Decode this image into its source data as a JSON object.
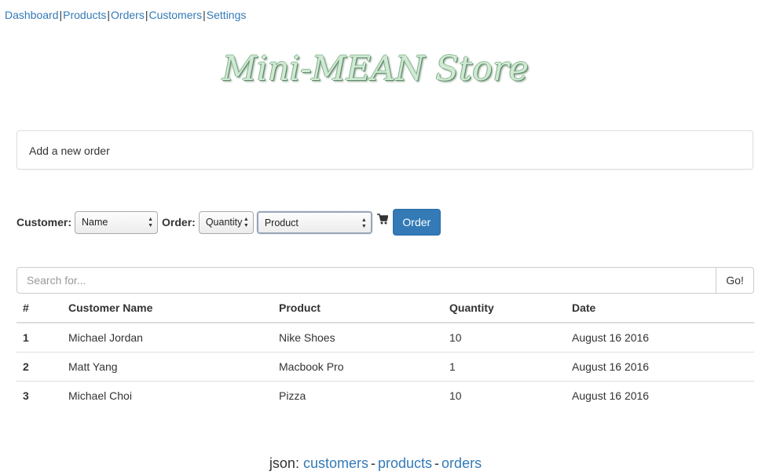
{
  "nav": {
    "items": [
      {
        "label": "Dashboard"
      },
      {
        "label": "Products"
      },
      {
        "label": "Orders"
      },
      {
        "label": "Customers"
      },
      {
        "label": "Settings"
      }
    ],
    "separator": "|"
  },
  "brand": {
    "title": "Mini-MEAN Store"
  },
  "panel": {
    "heading": "Add a new order"
  },
  "order_form": {
    "customer_label": "Customer:",
    "customer_select": "Name",
    "order_label": "Order:",
    "quantity_select": "Quantity",
    "product_select": "Product",
    "cart_icon": "shopping-cart-icon",
    "order_button": "Order"
  },
  "search": {
    "placeholder": "Search for...",
    "value": "",
    "go_button": "Go!"
  },
  "table": {
    "headers": [
      "#",
      "Customer Name",
      "Product",
      "Quantity",
      "Date"
    ],
    "rows": [
      {
        "num": "1",
        "customer": "Michael Jordan",
        "product": "Nike Shoes",
        "quantity": "10",
        "date": "August 16 2016"
      },
      {
        "num": "2",
        "customer": "Matt Yang",
        "product": "Macbook Pro",
        "quantity": "1",
        "date": "August 16 2016"
      },
      {
        "num": "3",
        "customer": "Michael Choi",
        "product": "Pizza",
        "quantity": "10",
        "date": "August 16 2016"
      }
    ]
  },
  "footer": {
    "prefix": "json:",
    "links": [
      {
        "label": "customers"
      },
      {
        "label": "products"
      },
      {
        "label": "orders"
      }
    ],
    "separator": "-"
  },
  "colors": {
    "link": "#337ab7",
    "primary_button": "#337ab7",
    "brand_fill": "#cfe9d3",
    "border": "#dddddd"
  }
}
